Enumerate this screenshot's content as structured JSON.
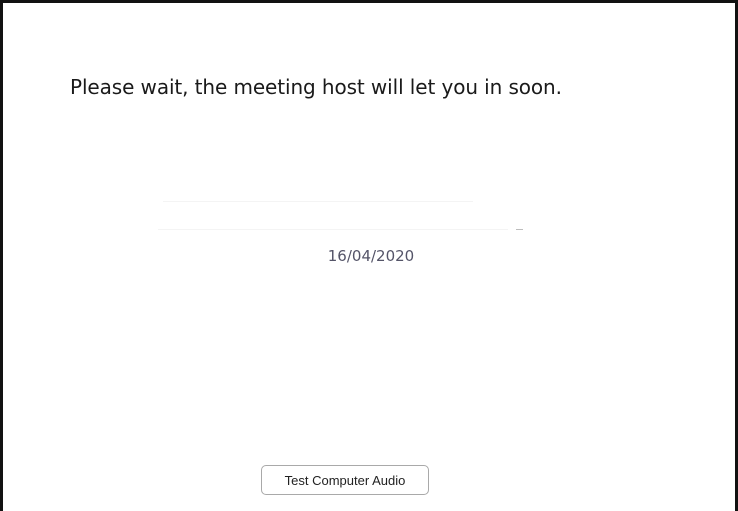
{
  "waiting_room": {
    "message": "Please wait, the meeting host will let you in soon.",
    "date": "16/04/2020",
    "test_audio_label": "Test Computer Audio"
  },
  "colors": {
    "message_text": "#1a1a1a",
    "date_text": "#545468",
    "button_border": "#a9a9a9",
    "window_border": "#111111"
  }
}
